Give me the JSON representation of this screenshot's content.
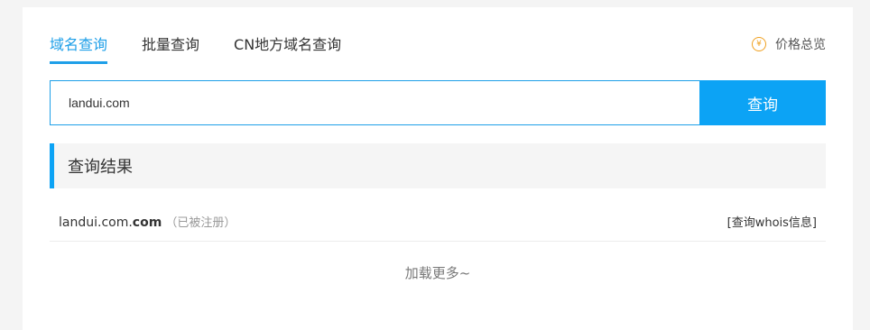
{
  "tabs": [
    {
      "label": "域名查询",
      "active": true
    },
    {
      "label": "批量查询",
      "active": false
    },
    {
      "label": "CN地方域名查询",
      "active": false
    }
  ],
  "price_overview": {
    "icon": "yen-circle-icon",
    "icon_glyph": "¥",
    "label": "价格总览"
  },
  "search": {
    "value": "landui.com",
    "button_label": "查询"
  },
  "results": {
    "title": "查询结果",
    "rows": [
      {
        "domain_base": "landui.com.",
        "domain_suffix": "com",
        "status": "（已被注册）",
        "whois_label": "[查询whois信息]"
      }
    ],
    "load_more_label": "加载更多~"
  },
  "colors": {
    "accent": "#1e9fe8",
    "button": "#0ca3f5",
    "price_icon": "#f0a020"
  }
}
